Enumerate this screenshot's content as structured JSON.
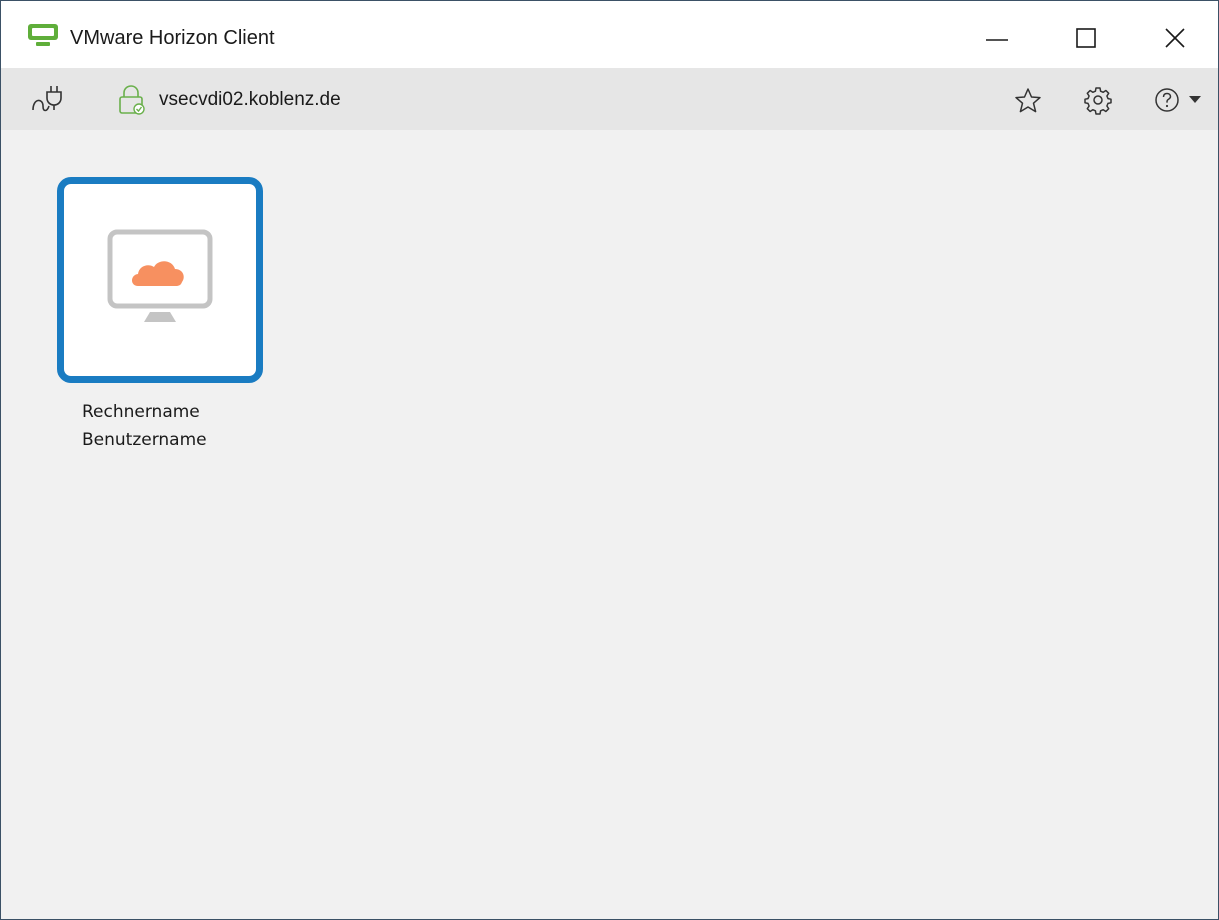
{
  "window": {
    "title": "VMware Horizon Client",
    "controls": {
      "minimize_icon": "minimize-icon",
      "maximize_icon": "maximize-icon",
      "close_icon": "close-icon"
    }
  },
  "toolbar": {
    "server": "vsecvdi02.koblenz.de",
    "icons": [
      "plug-icon",
      "lock-icon",
      "star-icon",
      "gear-icon",
      "help-icon",
      "chevron-down-icon"
    ]
  },
  "desktops": [
    {
      "name": "Rechnername",
      "user": "Benutzername",
      "icon": "monitor-cloud-icon",
      "selected": true
    }
  ],
  "colors": {
    "brand_green": "#5fae3a",
    "selection_blue": "#1a7cc2",
    "cloud_orange": "#f79060",
    "lock_green": "#6ab04c"
  }
}
